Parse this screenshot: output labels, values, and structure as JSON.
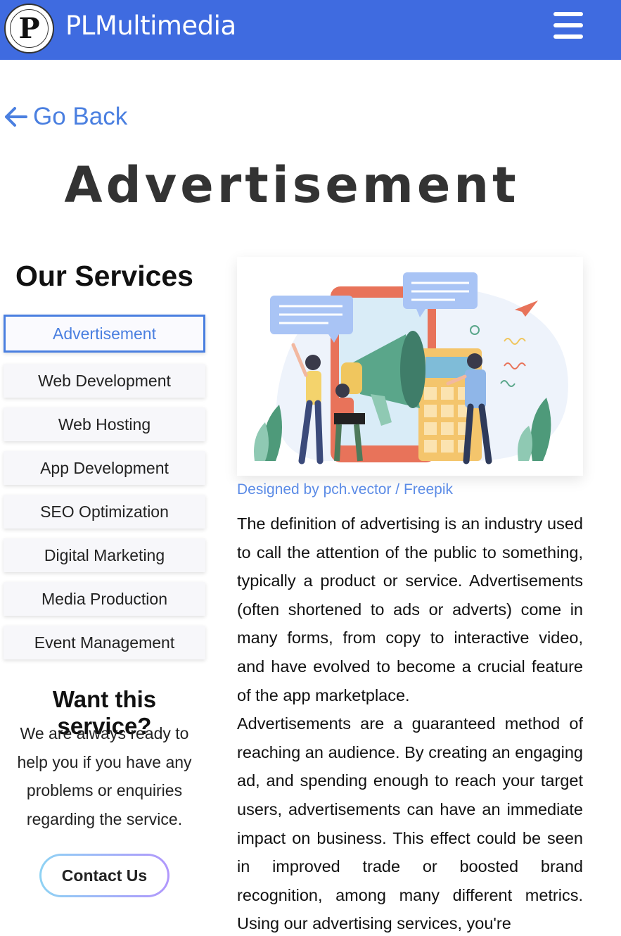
{
  "navbar": {
    "logo_letter": "P",
    "brand": "PLMultimedia",
    "menu_icon": "hamburger-menu-icon"
  },
  "back": {
    "label": "Go Back",
    "icon": "arrow-left-icon"
  },
  "page": {
    "title": "Advertisement"
  },
  "sidebar": {
    "title": "Our Services",
    "items": [
      {
        "label": "Advertisement",
        "active": true
      },
      {
        "label": "Web Development",
        "active": false
      },
      {
        "label": "Web Hosting",
        "active": false
      },
      {
        "label": "App Development",
        "active": false
      },
      {
        "label": "SEO Optimization",
        "active": false
      },
      {
        "label": "Digital Marketing",
        "active": false
      },
      {
        "label": "Media Production",
        "active": false
      },
      {
        "label": "Event Management",
        "active": false
      }
    ]
  },
  "cta": {
    "title": "Want this service?",
    "text": "We are always ready to help you if you have any problems or enquiries regarding the service.",
    "button": "Contact Us"
  },
  "article": {
    "credit": "Designed by pch.vector / Freepik",
    "paragraphs": [
      "The definition of advertising is an industry used to call the attention of the public to something, typically a product or service. Advertisements (often shortened to ads or adverts) come in many forms, from copy to interactive video, and have evolved to become a crucial feature of the app marketplace.",
      "Advertisements are a guaranteed method of reaching an audience. By creating an engaging ad, and spending enough to reach your target users, advertisements can have an immediate impact on business. This effect could be seen in improved trade or boosted brand recognition, among many different metrics. Using our advertising services, you're"
    ]
  },
  "colors": {
    "navbar": "#3f6be0",
    "accent": "#4a7fe0",
    "title": "#333333"
  }
}
